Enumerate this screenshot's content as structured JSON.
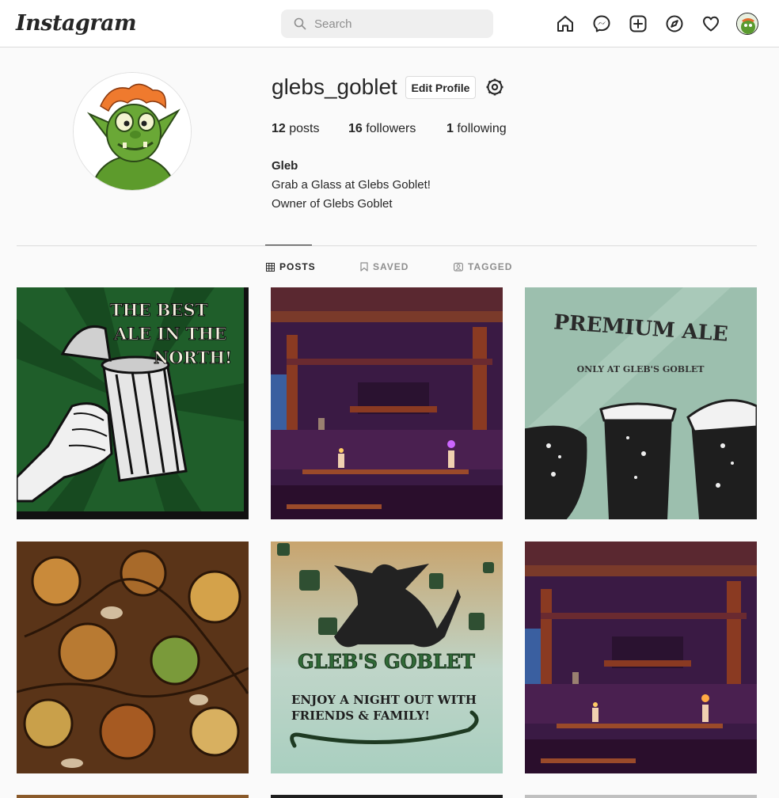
{
  "app": {
    "logo_text": "Instagram"
  },
  "search": {
    "placeholder": "Search"
  },
  "profile": {
    "username": "glebs_goblet",
    "edit_label": "Edit Profile",
    "posts_count": "12",
    "posts_label": "posts",
    "followers_count": "16",
    "followers_label": "followers",
    "following_count": "1",
    "following_label": "following",
    "full_name": "Gleb",
    "bio_line1": "Grab a Glass at Glebs Goblet!",
    "bio_line2": "Owner of Glebs Goblet"
  },
  "tabs": [
    {
      "label": "POSTS",
      "icon": "grid-icon",
      "active": true
    },
    {
      "label": "SAVED",
      "icon": "bookmark-icon",
      "active": false
    },
    {
      "label": "TAGGED",
      "icon": "tag-user-icon",
      "active": false
    }
  ],
  "posts": {
    "post1": {
      "line1": "THE BEST",
      "line2": "ALE IN THE",
      "line3": "NORTH!"
    },
    "post3": {
      "title": "PREMIUM ALE",
      "subtitle": "ONLY AT GLEB'S GOBLET"
    },
    "post5": {
      "title": "GLEB'S GOBLET",
      "line1": "ENJOY A NIGHT OUT WITH",
      "line2": "FRIENDS & FAMILY!"
    }
  },
  "colors": {
    "accent_green": "#1f5e2a",
    "tavern_purple": "#4a2050",
    "mint": "#9cbfae"
  }
}
